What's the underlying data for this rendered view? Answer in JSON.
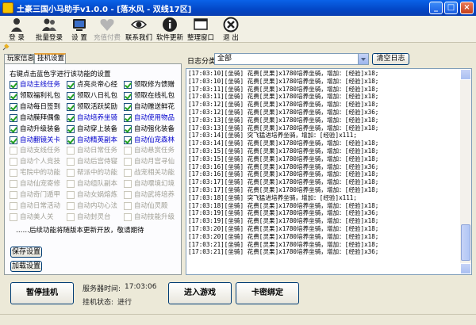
{
  "window": {
    "title": "土豪三国小马助手v1.0.0 - [落水风 - 双线17区]",
    "controls": [
      "_",
      "□",
      "×"
    ]
  },
  "toolbar": {
    "items": [
      {
        "label": "登  录",
        "icon": "login-icon",
        "enabled": true
      },
      {
        "label": "批量登录",
        "icon": "batch-login-icon",
        "enabled": true
      },
      {
        "label": "设  置",
        "icon": "settings-icon",
        "enabled": true
      },
      {
        "label": "充值付费",
        "icon": "heart-icon",
        "enabled": false
      },
      {
        "label": "联系我们",
        "icon": "eye-icon",
        "enabled": true
      },
      {
        "label": "软件更新",
        "icon": "info-icon",
        "enabled": true
      },
      {
        "label": "整理窗口",
        "icon": "window-icon",
        "enabled": true
      },
      {
        "label": "退  出",
        "icon": "close-circle-icon",
        "enabled": true
      }
    ]
  },
  "tabs": [
    {
      "label": "玩家信息",
      "active": false
    },
    {
      "label": "挂机设置",
      "active": true
    }
  ],
  "left_panel": {
    "hint": "右键点击蓝色字进行该功能的设置",
    "features": [
      {
        "label": "自动主线任务",
        "checked": true,
        "blue": true
      },
      {
        "label": "点亮炎帝心经",
        "checked": true,
        "blue": false
      },
      {
        "label": "领取修为馈赠",
        "checked": true,
        "blue": false
      },
      {
        "label": "领取福利礼包",
        "checked": true,
        "blue": false
      },
      {
        "label": "领取八日礼包",
        "checked": true,
        "blue": false
      },
      {
        "label": "领取在线礼包",
        "checked": true,
        "blue": false
      },
      {
        "label": "自动每日签到",
        "checked": true,
        "blue": false
      },
      {
        "label": "领取活跃奖励",
        "checked": true,
        "blue": false
      },
      {
        "label": "自动赠送鲜花",
        "checked": true,
        "blue": false
      },
      {
        "label": "自动膜拜偶像",
        "checked": true,
        "blue": false
      },
      {
        "label": "自动培养坐骑",
        "checked": true,
        "blue": true
      },
      {
        "label": "自动使用物品",
        "checked": true,
        "blue": true
      },
      {
        "label": "自动升级装备",
        "checked": true,
        "blue": false
      },
      {
        "label": "自动穿上装备",
        "checked": true,
        "blue": false
      },
      {
        "label": "自动强化装备",
        "checked": true,
        "blue": false
      },
      {
        "label": "自动翻镜关卡",
        "checked": true,
        "blue": true
      },
      {
        "label": "自动精英副本",
        "checked": true,
        "blue": true
      },
      {
        "label": "自动仙宠森林",
        "checked": true,
        "blue": true
      },
      {
        "label": "自动支线任务",
        "checked": false,
        "blue": false
      },
      {
        "label": "自动日常任务",
        "checked": false,
        "blue": false
      },
      {
        "label": "自动悬赏任务",
        "checked": false,
        "blue": false
      },
      {
        "label": "自动个人竞技",
        "checked": false,
        "blue": false
      },
      {
        "label": "自动后宫侍寝",
        "checked": false,
        "blue": false
      },
      {
        "label": "自动月宫寻仙",
        "checked": false,
        "blue": false
      },
      {
        "label": "宅院中的功能",
        "checked": false,
        "blue": false
      },
      {
        "label": "帮派中的功能",
        "checked": false,
        "blue": false
      },
      {
        "label": "战宠相关功能",
        "checked": false,
        "blue": false
      },
      {
        "label": "自动仙宠寄修",
        "checked": false,
        "blue": false
      },
      {
        "label": "自动组队副本",
        "checked": false,
        "blue": false
      },
      {
        "label": "自动嘌境幻境",
        "checked": false,
        "blue": false
      },
      {
        "label": "自动奇门遁甲",
        "checked": false,
        "blue": false
      },
      {
        "label": "自动女娲熔炼",
        "checked": false,
        "blue": false
      },
      {
        "label": "自动武将培养",
        "checked": false,
        "blue": false
      },
      {
        "label": "自动日常活动",
        "checked": false,
        "blue": false
      },
      {
        "label": "自动内功心法",
        "checked": false,
        "blue": false
      },
      {
        "label": "自动仙灵殿",
        "checked": false,
        "blue": false
      },
      {
        "label": "自动美人关",
        "checked": false,
        "blue": false
      },
      {
        "label": "自动封灵台",
        "checked": false,
        "blue": false
      },
      {
        "label": "自动技能升级",
        "checked": false,
        "blue": false
      }
    ],
    "footnote": "……后续功能将随版本更新开放，敬请期待",
    "save_label": "保存设置",
    "load_label": "加载设置"
  },
  "log": {
    "category_label": "日志分类",
    "category_value": "全部",
    "clear_label": "清空日志",
    "lines": [
      "[17:03:10][坐骑] 花费[灵果]x1780培养坐骑，增加：[经验]x18;",
      "[17:03:10][坐骑] 花费[灵果]x1780培养坐骑，增加：[经验]x18;",
      "[17:03:11][坐骑] 花费[灵果]x1780培养坐骑，增加：[经验]x18;",
      "[17:03:11][坐骑] 花费[灵果]x1780培养坐骑，增加：[经验]x18;",
      "[17:03:12][坐骑] 花费[灵果]x1780培养坐骑，增加：[经验]x18;",
      "[17:03:12][坐骑] 花费[灵果]x1780培养坐骑，增加：[经验]x36;",
      "[17:03:13][坐骑] 花费[灵果]x1780培养坐骑，增加：[经验]x18;",
      "[17:03:13][坐骑] 花费[灵果]x1780培养坐骑，增加：[经验]x18;",
      "[17:03:14][坐骑] 突飞猛进培养坐骑，增加：[经验]x111;",
      "[17:03:14][坐骑] 花费[灵果]x1780培养坐骑，增加：[经验]x18;",
      "[17:03:15][坐骑] 花费[灵果]x1780培养坐骑，增加：[经验]x18;",
      "[17:03:15][坐骑] 花费[灵果]x1780培养坐骑，增加：[经验]x18;",
      "[17:03:16][坐骑] 花费[灵果]x1780培养坐骑，增加：[经验]x36;",
      "[17:03:16][坐骑] 花费[灵果]x1780培养坐骑，增加：[经验]x18;",
      "[17:03:17][坐骑] 花费[灵果]x1780培养坐骑，增加：[经验]x18;",
      "[17:03:17][坐骑] 花费[灵果]x1780培养坐骑，增加：[经验]x18;",
      "[17:03:18][坐骑] 突飞猛进培养坐骑，增加：[经验]x111;",
      "[17:03:18][坐骑] 花费[灵果]x1780培养坐骑，增加：[经验]x18;",
      "[17:03:19][坐骑] 花费[灵果]x1780培养坐骑，增加：[经验]x36;",
      "[17:03:19][坐骑] 花费[灵果]x1780培养坐骑，增加：[经验]x18;",
      "[17:03:20][坐骑] 花费[灵果]x1780培养坐骑，增加：[经验]x18;",
      "[17:03:20][坐骑] 花费[灵果]x1780培养坐骑，增加：[经验]x18;",
      "[17:03:21][坐骑] 花费[灵果]x1780培养坐骑，增加：[经验]x18;",
      "[17:03:21][坐骑] 花费[灵果]x1780培养坐骑，增加：[经验]x36;"
    ]
  },
  "bottom": {
    "pause_label": "暂停挂机",
    "server_time_label": "服务器时间:",
    "server_time_value": "17:03:06",
    "status_label": "挂机状态:",
    "status_value": "进行",
    "enter_game_label": "进入游戏",
    "card_bind_label": "卡密绑定"
  },
  "colors": {
    "blue_feature": "#0000cc",
    "title_bar": "#0a55d8"
  }
}
